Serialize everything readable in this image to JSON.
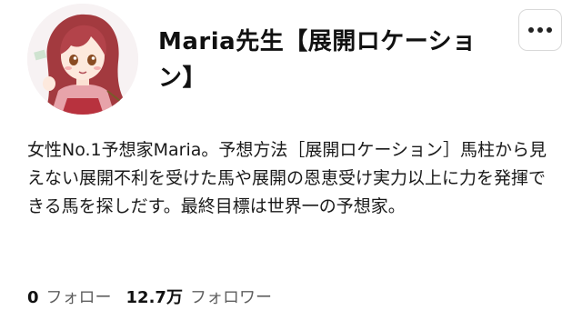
{
  "profile": {
    "name": "Maria先生【展開ロケーション】",
    "bio": "女性No.1予想家Maria。予想方法［展開ロケーション］馬柱から見えない展開不利を受けた馬や展開の恩恵受け実力以上に力を発揮できる馬を探しだす。最終目標は世界一の予想家。",
    "avatar_icon": "illustrated-girl-avatar"
  },
  "actions": {
    "more_icon": "ellipsis-icon"
  },
  "stats": {
    "following_count": "0",
    "following_label": "フォロー",
    "followers_count": "12.7万",
    "followers_label": "フォロワー"
  },
  "colors": {
    "hair": "#a33a3f",
    "accent": "#c65058",
    "text": "#1a1a1a",
    "muted": "#5f5f5f",
    "border": "#d9d9d9"
  }
}
